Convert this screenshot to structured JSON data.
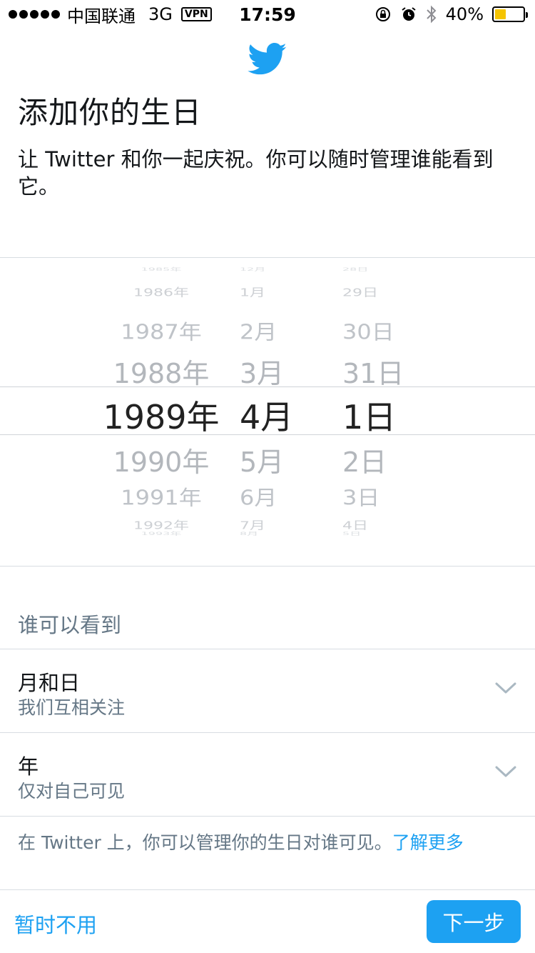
{
  "status_bar": {
    "carrier": "中国联通",
    "network": "3G",
    "vpn": "VPN",
    "time": "17:59",
    "battery": "40%",
    "battery_level": 0.4,
    "icons": [
      "signal-dots-icon",
      "orientation-lock-icon",
      "alarm-icon",
      "bluetooth-icon",
      "battery-icon"
    ]
  },
  "header": {
    "logo": "twitter-bird-icon",
    "title": "添加你的生日",
    "description": "让 Twitter 和你一起庆祝。你可以随时管理谁能看到它。"
  },
  "picker": {
    "years": [
      "1985年",
      "1986年",
      "1987年",
      "1988年",
      "1989年",
      "1990年",
      "1991年",
      "1992年",
      "1993年"
    ],
    "months": [
      "12月",
      "1月",
      "2月",
      "3月",
      "4月",
      "5月",
      "6月",
      "7月",
      "8月"
    ],
    "days": [
      "28日",
      "29日",
      "30日",
      "31日",
      "1日",
      "2日",
      "3日",
      "4日",
      "5日"
    ],
    "selected": {
      "year": "1989年",
      "month": "4月",
      "day": "1日"
    }
  },
  "visibility": {
    "label": "谁可以看到",
    "rows": [
      {
        "title": "月和日",
        "value": "我们互相关注"
      },
      {
        "title": "年",
        "value": "仅对自己可见"
      }
    ]
  },
  "footnote": {
    "text": "在 Twitter 上，你可以管理你的生日对谁可见。",
    "link": "了解更多"
  },
  "actions": {
    "skip": "暂时不用",
    "next": "下一步"
  },
  "colors": {
    "accent": "#1da1f2",
    "secondary_text": "#657786",
    "battery": "#f5c400"
  }
}
